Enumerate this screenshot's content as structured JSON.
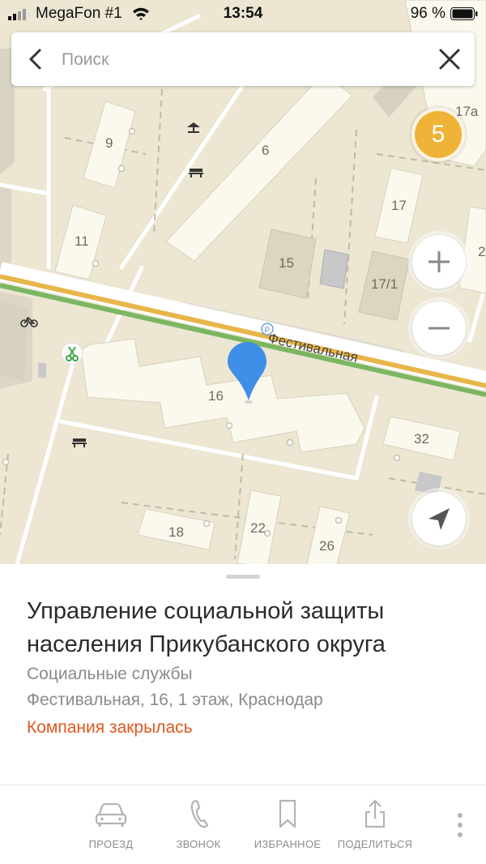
{
  "status_bar": {
    "carrier": "MegaFon #1",
    "time": "13:54",
    "battery_percent": "96 %"
  },
  "search": {
    "placeholder": "Поиск"
  },
  "map": {
    "cluster_count": "5",
    "street_label": "Фестивальная",
    "building_numbers": [
      "17a",
      "9",
      "6",
      "17",
      "2",
      "11",
      "15",
      "17/1",
      "16",
      "32",
      "18",
      "22",
      "26"
    ],
    "parking_symbol": "P",
    "colors": {
      "road_yellow": "#e8b54a",
      "road_green": "#7bb661",
      "pin_blue": "#3f8ee8",
      "cluster_orange": "#efb337"
    },
    "icons": [
      "bench-icon",
      "pavilion-icon",
      "bicycle-icon",
      "scissors-poi-icon",
      "parking-icon"
    ]
  },
  "place": {
    "title": "Управление социальной защиты населения Прикубанского округа",
    "category": "Социальные службы",
    "address": "Фестивальная, 16, 1 этаж, Краснодар",
    "status": "Компания закрылась",
    "status_color": "#e0581e"
  },
  "actions": {
    "route": "ПРОЕЗД",
    "call": "ЗВОНОК",
    "favorite": "ИЗБРАННОЕ",
    "share": "ПОДЕЛИТЬСЯ"
  }
}
